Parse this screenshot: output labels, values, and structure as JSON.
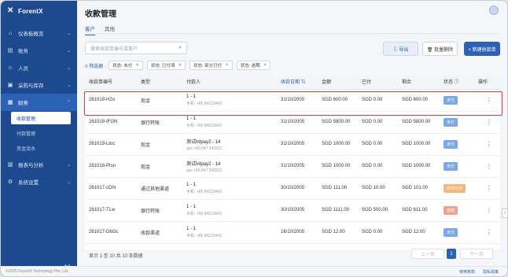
{
  "app": {
    "logo_text": "ForentX"
  },
  "sidebar": {
    "items": [
      {
        "label": "仪表板概览",
        "icon": "⌂"
      },
      {
        "label": "账务",
        "icon": "▤"
      },
      {
        "label": "人员",
        "icon": "☺"
      },
      {
        "label": "采购与库存",
        "icon": "▣"
      },
      {
        "label": "财务",
        "icon": "▦"
      }
    ],
    "subitems": [
      {
        "label": "收款管理"
      },
      {
        "label": "付款管理"
      },
      {
        "label": "资金流水"
      }
    ],
    "items2": [
      {
        "label": "报表与分析",
        "icon": "▥"
      },
      {
        "label": "系统设置",
        "icon": "⚙"
      }
    ],
    "collapse": "↤"
  },
  "header": {
    "title": "收款管理"
  },
  "tabs": [
    {
      "label": "客户"
    },
    {
      "label": "其他"
    }
  ],
  "search": {
    "placeholder": "搜索收款单编号或客户",
    "icon": "⌕"
  },
  "buttons": {
    "export": "⇩ 导出",
    "batch": "🗑 批量删除",
    "create": "+ 新建收款单"
  },
  "filters": {
    "label": "≡ 筛选器",
    "chips": [
      "状态: 未付",
      "状态: 已付清",
      "状态: 部分已付",
      "状态: 逾期"
    ]
  },
  "table": {
    "columns": [
      "收款单编号",
      "类型",
      "付款人",
      "收款日期 ⇅",
      "金额",
      "已付",
      "剩余",
      "状态 ⓘ",
      "操作"
    ],
    "rows": [
      {
        "id": "261019-H2o",
        "type": "现金",
        "payer": "1 - 1",
        "payer_sub": "手机: +65 84123443",
        "date": "31/10/2005",
        "amount": "SGD 600.00",
        "paid": "SGD 0.00",
        "remaining": "SGD 600.00",
        "status": "未付",
        "color": "blue"
      },
      {
        "id": "261019-IFGN",
        "type": "银行转账",
        "payer": "1 - 1",
        "payer_sub": "手机: +65 84123443",
        "date": "31/10/2005",
        "amount": "SGD 5800.00",
        "paid": "SGD 0.00",
        "remaining": "SGD 5800.00",
        "status": "未付",
        "color": "blue"
      },
      {
        "id": "261019-Ltoc",
        "type": "现金",
        "payer": "测试hitpay2 - 14",
        "payer_sub": "qyx +60 847 243321",
        "date": "31/10/2005",
        "amount": "SGD 1000.00",
        "paid": "SGD 0.00",
        "remaining": "SGD 1000.00",
        "status": "未付",
        "color": "blue"
      },
      {
        "id": "261018-Ptsn",
        "type": "现金",
        "payer": "测试hitpay2 - 14",
        "payer_sub": "qyx +60 847 243321",
        "date": "31/10/2005",
        "amount": "SGD 1000.00",
        "paid": "SGD 0.00",
        "remaining": "SGD 1000.00",
        "status": "未付",
        "color": "blue"
      },
      {
        "id": "261017-cDhr",
        "type": "通过其他渠道",
        "payer": "1 - 1",
        "payer_sub": "手机: +65 84123443",
        "date": "30/10/2005",
        "amount": "SGD 111.00",
        "paid": "SGD 10.00",
        "remaining": "SGD 101.00",
        "status": "部分已付",
        "color": "orange"
      },
      {
        "id": "261017-TLw",
        "type": "银行转账",
        "payer": "1 - 1",
        "payer_sub": "手机: +65 84123443",
        "date": "30/10/2005",
        "amount": "SGD 1111.00",
        "paid": "SGD 500.00",
        "remaining": "SGD 611.00",
        "status": "逾期",
        "color": "red"
      },
      {
        "id": "261017-D6Gc",
        "type": "收款渠道",
        "payer": "1 - 1",
        "payer_sub": "手机: +65 84123443",
        "date": "16/10/2005",
        "amount": "SGD 12.00",
        "paid": "SGD 0.00",
        "remaining": "SGD 12.00",
        "status": "未付",
        "color": "blue"
      }
    ]
  },
  "pagination": {
    "summary": "显示 1 至 10 共 10 条数据",
    "prev": "上一页",
    "page": "1",
    "next": "下一页"
  },
  "footer": {
    "copyright": "©2025 ForentX Technology Pte. Ltd.",
    "link1": "使用条款",
    "link2": "隐私政策"
  },
  "side_handle": "‹"
}
